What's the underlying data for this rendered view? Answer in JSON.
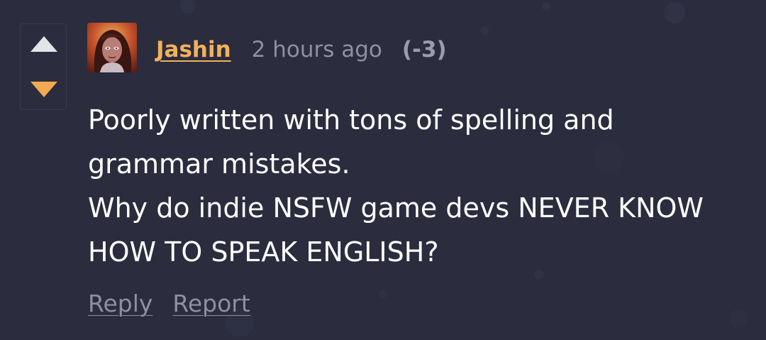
{
  "vote": {
    "up_icon": "triangle-up-icon",
    "down_icon": "triangle-down-icon",
    "up_color": "#e3e4ea",
    "down_color": "#f3a94f",
    "state": "downvoted"
  },
  "comment": {
    "author": "Jashin",
    "timestamp": "2 hours ago",
    "score": "(-3)",
    "body_lines": [
      "Poorly written with tons of spelling and grammar mistakes.",
      "Why do indie NSFW game devs NEVER KNOW HOW TO SPEAK ENGLISH?"
    ],
    "avatar_icon": "user-avatar"
  },
  "actions": {
    "reply": "Reply",
    "report": "Report"
  },
  "colors": {
    "background": "#2b2c3d",
    "username": "#f1b15b",
    "muted_text": "#8e909f",
    "body_text": "#ffffff"
  }
}
